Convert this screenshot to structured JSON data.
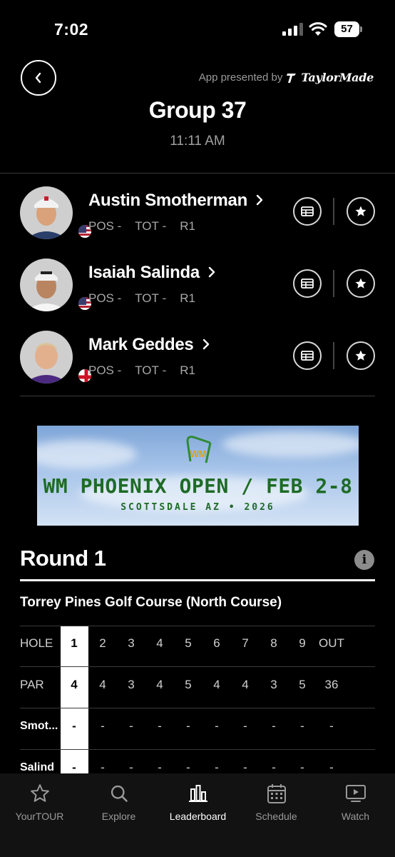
{
  "status_bar": {
    "time": "7:02",
    "battery": "57"
  },
  "header": {
    "presented_by": "App presented by",
    "sponsor_logo": "TaylorMade",
    "title": "Group 37",
    "tee_time": "11:11 AM"
  },
  "players": [
    {
      "name": "Austin Smotherman",
      "pos_label": "POS",
      "pos_value": "-",
      "tot_label": "TOT",
      "tot_value": "-",
      "round": "R1",
      "flag": "USA"
    },
    {
      "name": "Isaiah Salinda",
      "pos_label": "POS",
      "pos_value": "-",
      "tot_label": "TOT",
      "tot_value": "-",
      "round": "R1",
      "flag": "USA"
    },
    {
      "name": "Mark Geddes",
      "pos_label": "POS",
      "pos_value": "-",
      "tot_label": "TOT",
      "tot_value": "-",
      "round": "R1",
      "flag": "England"
    }
  ],
  "banner": {
    "logo_text": "WM",
    "title": "WM PHOENIX OPEN / FEB 2-8",
    "subtitle": "SCOTTSDALE AZ • 2026"
  },
  "round": {
    "title": "Round 1",
    "course": "Torrey Pines Golf Course (North Course)"
  },
  "scorecard": {
    "rows": [
      {
        "label": "HOLE",
        "cells": [
          "1",
          "2",
          "3",
          "4",
          "5",
          "6",
          "7",
          "8",
          "9",
          "OUT"
        ]
      },
      {
        "label": "PAR",
        "cells": [
          "4",
          "4",
          "3",
          "4",
          "5",
          "4",
          "4",
          "3",
          "5",
          "36"
        ]
      },
      {
        "label": "Smot...",
        "cells": [
          "-",
          "-",
          "-",
          "-",
          "-",
          "-",
          "-",
          "-",
          "-",
          "-"
        ]
      },
      {
        "label": "Salind",
        "cells": [
          "-",
          "-",
          "-",
          "-",
          "-",
          "-",
          "-",
          "-",
          "-",
          "-"
        ]
      }
    ]
  },
  "bottom_nav": [
    {
      "label": "YourTOUR",
      "icon": "star-icon",
      "active": false
    },
    {
      "label": "Explore",
      "icon": "search-icon",
      "active": false
    },
    {
      "label": "Leaderboard",
      "icon": "bar-chart-icon",
      "active": true
    },
    {
      "label": "Schedule",
      "icon": "calendar-icon",
      "active": false
    },
    {
      "label": "Watch",
      "icon": "tv-icon",
      "active": false
    }
  ],
  "colors": {
    "background": "#000000",
    "accent_green": "#1e6b26",
    "muted_text": "#a8a8a8"
  }
}
